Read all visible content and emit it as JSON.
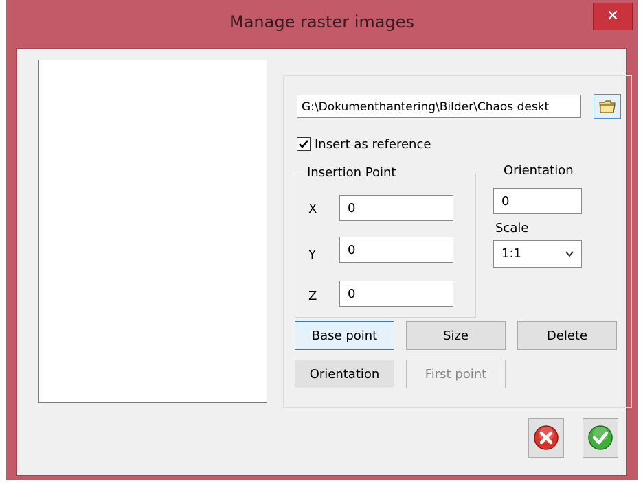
{
  "window": {
    "title": "Manage raster images",
    "close_symbol": "✕"
  },
  "file": {
    "path": "G:\\Dokumenthantering\\Bilder\\Chaos deskt",
    "browse_icon": "folder-icon"
  },
  "options": {
    "insert_as_reference_label": "Insert as reference",
    "insert_as_reference_checked": true
  },
  "insertion_point": {
    "legend": "Insertion Point",
    "x_label": "X",
    "x_value": "0",
    "y_label": "Y",
    "y_value": "0",
    "z_label": "Z",
    "z_value": "0"
  },
  "orientation": {
    "label": "Orientation",
    "value": "0"
  },
  "scale": {
    "label": "Scale",
    "selected": "1:1"
  },
  "buttons": {
    "base_point": "Base point",
    "size": "Size",
    "delete": "Delete",
    "orientation": "Orientation",
    "first_point": "First point"
  },
  "footer": {
    "cancel_icon": "cancel-icon",
    "ok_icon": "ok-icon"
  },
  "colors": {
    "window_frame": "#c25a68",
    "close_button": "#c8333d",
    "cancel_red": "#d9342b",
    "ok_green": "#3fae3a"
  }
}
